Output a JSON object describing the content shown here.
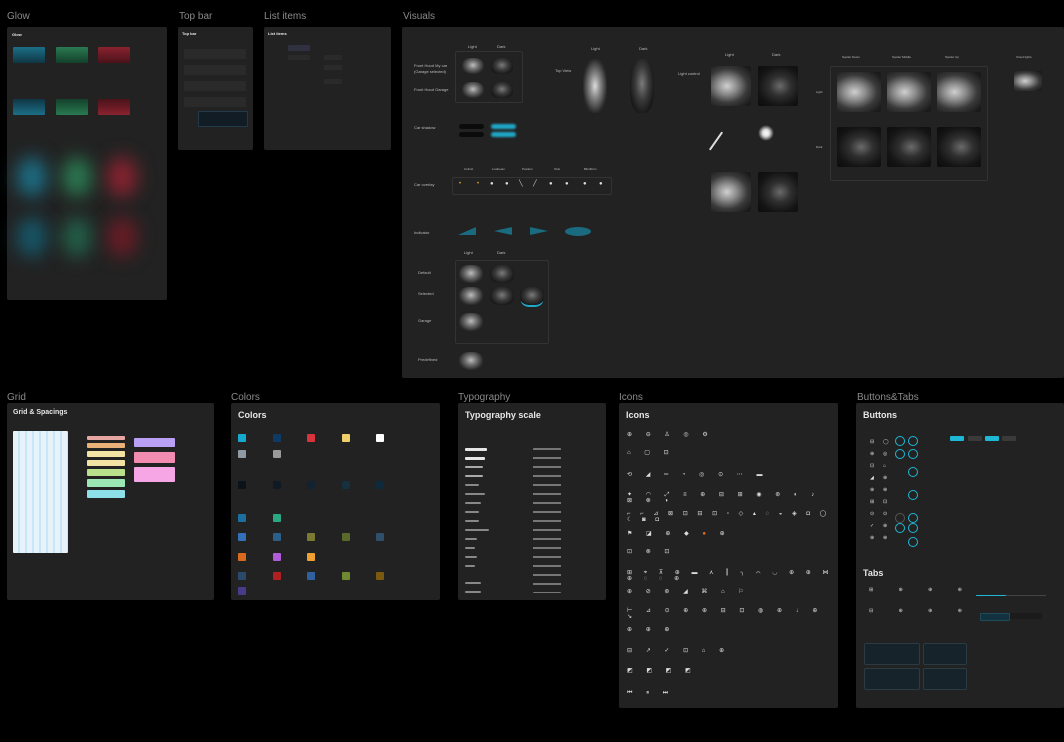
{
  "sections": {
    "glow": "Glow",
    "top_bar": "Top bar",
    "list_items": "List items",
    "visuals": "Visuals",
    "grid": "Grid",
    "colors": "Colors",
    "typography": "Typography",
    "icons": "Icons",
    "buttons_tabs": "Buttons&Tabs"
  },
  "frames": {
    "glow_title": "Glow",
    "top_bar_title": "Top bar",
    "list_items_title": "List items",
    "grid_title": "Grid & Spacings",
    "colors_title": "Colors",
    "typography_title": "Typography scale",
    "icons_title": "Icons",
    "buttons_title": "Buttons",
    "tabs_title": "Tabs"
  },
  "visuals": {
    "col_light": "Light",
    "col_dark": "Dark",
    "row_front_hood_selected": "Front Hood My car (Garage selected)",
    "row_front_hood_garage": "Front Hood Garage",
    "row_car_shadow": "Car shadow",
    "row_car_overlay": "Car overlay",
    "row_indicator": "Indicator",
    "row_default": "Default",
    "row_selected": "Selected",
    "row_garage": "Garage",
    "row_predefined": "Predefined",
    "top_view": "Top View",
    "light_control": "Light control",
    "overlay_cols": [
      "Unlimit",
      "Lowbeam",
      "Position",
      "Strio",
      "Blindbrim"
    ],
    "spoiler_cols": [
      "Spoiler Down",
      "Spoiler Middle",
      "Spoiler Up"
    ],
    "spoiler_rows": [
      "Light",
      "Dark"
    ],
    "cloud_lights": "Cloud lights"
  },
  "colors": {
    "accent": "#1fb7d6",
    "panel": "#222222",
    "glow_colors": [
      "#1c6f86",
      "#2a7a52",
      "#8a2330"
    ],
    "main_swatches": [
      "#16a9cf",
      "#0e3a66",
      "#d8343e",
      "#f0cf6a",
      "#ffffff",
      "#8f9aa3",
      "#9a9a9a"
    ],
    "background_swatches": [
      "#0c1318",
      "#0f1a24",
      "#122230",
      "#163040",
      "#0f2a3a"
    ],
    "special_swatches": [
      "#1b6ea0",
      "#2aa883",
      "#3470b8",
      "#2a5f8a",
      "#7a7a30",
      "#5a6a2a",
      "#2f4f6a",
      "#d86a1e",
      "#b05cd8",
      "#f0a030",
      "#2a4a6a",
      "#b02020",
      "#3060a0",
      "#708a30",
      "#7a5a10",
      "#4a3a8a"
    ],
    "grid_bars": [
      "#e7a6a2",
      "#e9b077",
      "#f2e3a4",
      "#b9e08a",
      "#9be8b5",
      "#8ee0e8"
    ],
    "grid_boxes": [
      "#b9a0f5",
      "#f18bb0",
      "#f6a6e4"
    ]
  }
}
